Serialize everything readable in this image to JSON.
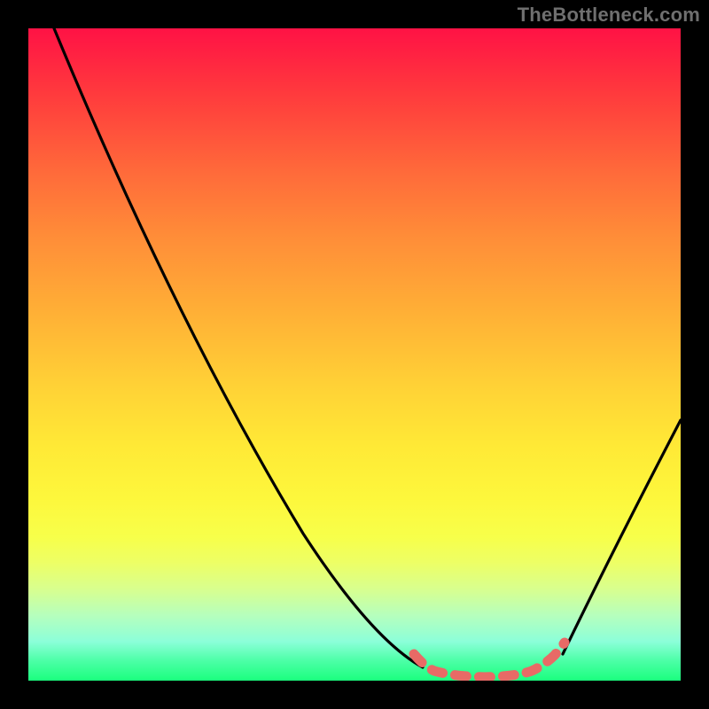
{
  "watermark": "TheBottleneck.com",
  "chart_data": {
    "type": "line",
    "title": "",
    "xlabel": "",
    "ylabel": "",
    "xlim": [
      0,
      100
    ],
    "ylim": [
      0,
      100
    ],
    "grid": false,
    "description": "Bottleneck-style V-curve over a rainbow gradient. Two black descending branches meet a flat salmon/red segment near the bottom indicating the optimal zone.",
    "series": [
      {
        "name": "left-branch",
        "color": "#000000",
        "x": [
          4,
          10,
          18,
          26,
          34,
          42,
          48,
          54,
          58,
          60.5
        ],
        "y": [
          100,
          86,
          71,
          56,
          42,
          28,
          18,
          9,
          4,
          2
        ]
      },
      {
        "name": "right-branch",
        "color": "#000000",
        "x": [
          82,
          100
        ],
        "y": [
          4,
          40
        ]
      },
      {
        "name": "optimal-zone",
        "color": "#e86a66",
        "x": [
          59,
          61,
          63,
          66,
          70,
          74,
          77,
          79,
          81,
          82
        ],
        "y": [
          4,
          1.6,
          0.9,
          0.6,
          0.5,
          0.6,
          0.9,
          1.9,
          3.4,
          4.2
        ]
      }
    ],
    "gradient_stops": [
      {
        "pos": 0,
        "color": "#ff1245"
      },
      {
        "pos": 10,
        "color": "#ff3a3d"
      },
      {
        "pos": 22,
        "color": "#ff6a3a"
      },
      {
        "pos": 32,
        "color": "#ff8d38"
      },
      {
        "pos": 44,
        "color": "#ffb136"
      },
      {
        "pos": 55,
        "color": "#ffd236"
      },
      {
        "pos": 64,
        "color": "#ffe936"
      },
      {
        "pos": 72,
        "color": "#fdf73c"
      },
      {
        "pos": 78,
        "color": "#f7ff4a"
      },
      {
        "pos": 82,
        "color": "#edff66"
      },
      {
        "pos": 86,
        "color": "#d8ff8f"
      },
      {
        "pos": 90,
        "color": "#b6ffbd"
      },
      {
        "pos": 94,
        "color": "#8cffd9"
      },
      {
        "pos": 97,
        "color": "#4bffa6"
      },
      {
        "pos": 100,
        "color": "#1bff7e"
      }
    ]
  }
}
